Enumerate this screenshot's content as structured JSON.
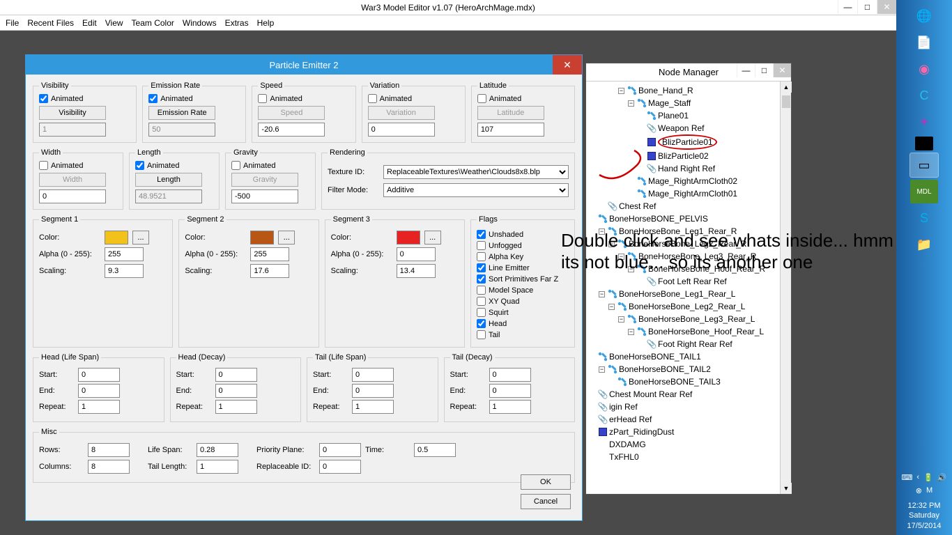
{
  "app": {
    "title": "War3 Model Editor v1.07 (HeroArchMage.mdx)",
    "menubar": [
      "File",
      "Recent Files",
      "Edit",
      "View",
      "Team Color",
      "Windows",
      "Extras",
      "Help"
    ]
  },
  "dialog_pe": {
    "title": "Particle Emitter 2",
    "groups": {
      "visibility": {
        "legend": "Visibility",
        "animated": true,
        "button": "Visibility",
        "value": "1",
        "disabled": true
      },
      "emission": {
        "legend": "Emission Rate",
        "animated": true,
        "button": "Emission Rate",
        "value": "50",
        "disabled": true
      },
      "speed": {
        "legend": "Speed",
        "animated": false,
        "button": "Speed",
        "value": "-20.6",
        "disabled": false
      },
      "variation": {
        "legend": "Variation",
        "animated": false,
        "button": "Variation",
        "value": "0",
        "disabled": false
      },
      "latitude": {
        "legend": "Latitude",
        "animated": false,
        "button": "Latitude",
        "value": "107",
        "disabled": false
      },
      "width": {
        "legend": "Width",
        "animated": false,
        "button": "Width",
        "value": "0",
        "disabled": false
      },
      "length": {
        "legend": "Length",
        "animated": true,
        "button": "Length",
        "value": "48.9521",
        "disabled": true
      },
      "gravity": {
        "legend": "Gravity",
        "animated": false,
        "button": "Gravity",
        "value": "-500",
        "disabled": false
      }
    },
    "rendering": {
      "legend": "Rendering",
      "texture_label": "Texture ID:",
      "texture_value": "ReplaceableTextures\\Weather\\Clouds8x8.blp",
      "filter_label": "Filter Mode:",
      "filter_value": "Additive"
    },
    "segments": [
      {
        "legend": "Segment 1",
        "color": "#f2c21a",
        "alpha": "255",
        "scaling": "9.3"
      },
      {
        "legend": "Segment 2",
        "color": "#b85613",
        "alpha": "255",
        "scaling": "17.6"
      },
      {
        "legend": "Segment 3",
        "color": "#e62222",
        "alpha": "0",
        "scaling": "13.4"
      }
    ],
    "labels": {
      "color": "Color:",
      "alpha": "Alpha (0 - 255):",
      "scaling": "Scaling:",
      "more": "...",
      "animated": "Animated"
    },
    "flags": {
      "legend": "Flags",
      "items": [
        {
          "label": "Unshaded",
          "checked": true
        },
        {
          "label": "Unfogged",
          "checked": false
        },
        {
          "label": "Alpha Key",
          "checked": false
        },
        {
          "label": "Line Emitter",
          "checked": true
        },
        {
          "label": "Sort Primitives Far Z",
          "checked": true
        },
        {
          "label": "Model Space",
          "checked": false
        },
        {
          "label": "XY Quad",
          "checked": false
        },
        {
          "label": "Squirt",
          "checked": false
        },
        {
          "label": "Head",
          "checked": true
        },
        {
          "label": "Tail",
          "checked": false
        }
      ]
    },
    "life": [
      {
        "legend": "Head (Life Span)",
        "start": "0",
        "end": "0",
        "repeat": "1"
      },
      {
        "legend": "Head (Decay)",
        "start": "0",
        "end": "0",
        "repeat": "1"
      },
      {
        "legend": "Tail (Life Span)",
        "start": "0",
        "end": "0",
        "repeat": "1"
      },
      {
        "legend": "Tail (Decay)",
        "start": "0",
        "end": "0",
        "repeat": "1"
      }
    ],
    "life_labels": {
      "start": "Start:",
      "end": "End:",
      "repeat": "Repeat:"
    },
    "misc": {
      "legend": "Misc",
      "rows_label": "Rows:",
      "rows": "8",
      "cols_label": "Columns:",
      "cols": "8",
      "lifespan_label": "Life Span:",
      "lifespan": "0.28",
      "taillen_label": "Tail Length:",
      "taillen": "1",
      "priority_label": "Priority Plane:",
      "priority": "0",
      "replid_label": "Replaceable ID:",
      "replid": "0",
      "time_label": "Time:",
      "time": "0.5"
    },
    "buttons": {
      "ok": "OK",
      "cancel": "Cancel"
    }
  },
  "node_manager": {
    "title": "Node Manager",
    "items": [
      {
        "indent": 3,
        "exp": "-",
        "ico": "bone",
        "label": "Bone_Hand_R"
      },
      {
        "indent": 4,
        "exp": "-",
        "ico": "bone",
        "label": "Mage_Staff"
      },
      {
        "indent": 5,
        "exp": "",
        "ico": "bone",
        "label": "Plane01"
      },
      {
        "indent": 5,
        "exp": "",
        "ico": "clip",
        "label": "Weapon Ref"
      },
      {
        "indent": 5,
        "exp": "",
        "ico": "part",
        "label": "BlizParticle01",
        "sel": true
      },
      {
        "indent": 5,
        "exp": "",
        "ico": "part",
        "label": "BlizParticle02"
      },
      {
        "indent": 5,
        "exp": "",
        "ico": "clip",
        "label": "Hand Right Ref"
      },
      {
        "indent": 4,
        "exp": "",
        "ico": "bone",
        "label": "Mage_RightArmCloth02"
      },
      {
        "indent": 4,
        "exp": "",
        "ico": "bone",
        "label": "Mage_RightArmCloth01"
      },
      {
        "indent": 1,
        "exp": "",
        "ico": "clip",
        "label": "Chest Ref"
      },
      {
        "indent": 0,
        "exp": "",
        "ico": "bone",
        "label": "BoneHorseBONE_PELVIS"
      },
      {
        "indent": 1,
        "exp": "-",
        "ico": "bone",
        "label": "BoneHorseBone_Leg1_Rear_R"
      },
      {
        "indent": 2,
        "exp": "-",
        "ico": "bone",
        "label": "BoneHorseBone_Leg2_Rear_R"
      },
      {
        "indent": 3,
        "exp": "-",
        "ico": "bone",
        "label": "BoneHorseBone_Leg3_Rear_R"
      },
      {
        "indent": 4,
        "exp": "-",
        "ico": "bone",
        "label": "BoneHorseBone_Hoof_Rear_R"
      },
      {
        "indent": 5,
        "exp": "",
        "ico": "clip",
        "label": "Foot Left Rear Ref"
      },
      {
        "indent": 1,
        "exp": "-",
        "ico": "bone",
        "label": "BoneHorseBone_Leg1_Rear_L"
      },
      {
        "indent": 2,
        "exp": "-",
        "ico": "bone",
        "label": "BoneHorseBone_Leg2_Rear_L"
      },
      {
        "indent": 3,
        "exp": "-",
        "ico": "bone",
        "label": "BoneHorseBone_Leg3_Rear_L"
      },
      {
        "indent": 4,
        "exp": "-",
        "ico": "bone",
        "label": "BoneHorseBone_Hoof_Rear_L"
      },
      {
        "indent": 5,
        "exp": "",
        "ico": "clip",
        "label": "Foot Right Rear Ref"
      },
      {
        "indent": 0,
        "exp": "",
        "ico": "bone",
        "label": "BoneHorseBONE_TAIL1"
      },
      {
        "indent": 1,
        "exp": "-",
        "ico": "bone",
        "label": "BoneHorseBONE_TAIL2"
      },
      {
        "indent": 2,
        "exp": "",
        "ico": "bone",
        "label": "BoneHorseBONE_TAIL3"
      },
      {
        "indent": 0,
        "exp": "",
        "ico": "clip",
        "label": "Chest Mount Rear Ref"
      },
      {
        "indent": 0,
        "exp": "",
        "ico": "clip",
        "label": "igin Ref"
      },
      {
        "indent": 0,
        "exp": "",
        "ico": "clip",
        "label": "erHead Ref"
      },
      {
        "indent": 0,
        "exp": "",
        "ico": "part",
        "label": "zPart_RidingDust"
      },
      {
        "indent": 0,
        "exp": "",
        "ico": "",
        "label": "DXDAMG"
      },
      {
        "indent": 0,
        "exp": "",
        "ico": "",
        "label": "TxFHL0"
      }
    ]
  },
  "annotation": "Double click and see whats inside... hmm its not blue... so its another one",
  "taskbar": {
    "clock": {
      "time": "12:32 PM",
      "day": "Saturday",
      "date": "17/5/2014"
    }
  }
}
